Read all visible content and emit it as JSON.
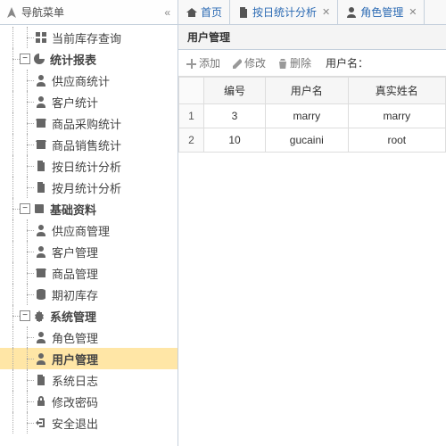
{
  "sidebar": {
    "title": "导航菜单",
    "items": [
      {
        "label": "当前库存查询",
        "indent": 2,
        "icon": "grid",
        "bold": false
      },
      {
        "label": "统计报表",
        "indent": 1,
        "icon": "pie",
        "expander": "-",
        "bold": true
      },
      {
        "label": "供应商统计",
        "indent": 2,
        "icon": "person",
        "bold": false
      },
      {
        "label": "客户统计",
        "indent": 2,
        "icon": "person",
        "bold": false
      },
      {
        "label": "商品采购统计",
        "indent": 2,
        "icon": "box",
        "bold": false
      },
      {
        "label": "商品销售统计",
        "indent": 2,
        "icon": "box",
        "bold": false
      },
      {
        "label": "按日统计分析",
        "indent": 2,
        "icon": "doc",
        "bold": false
      },
      {
        "label": "按月统计分析",
        "indent": 2,
        "icon": "doc",
        "bold": false
      },
      {
        "label": "基础资料",
        "indent": 1,
        "icon": "book",
        "expander": "-",
        "bold": true
      },
      {
        "label": "供应商管理",
        "indent": 2,
        "icon": "person",
        "bold": false
      },
      {
        "label": "客户管理",
        "indent": 2,
        "icon": "person",
        "bold": false
      },
      {
        "label": "商品管理",
        "indent": 2,
        "icon": "box",
        "bold": false
      },
      {
        "label": "期初库存",
        "indent": 2,
        "icon": "db",
        "bold": false
      },
      {
        "label": "系统管理",
        "indent": 1,
        "icon": "gear",
        "expander": "-",
        "bold": true
      },
      {
        "label": "角色管理",
        "indent": 2,
        "icon": "person",
        "bold": false
      },
      {
        "label": "用户管理",
        "indent": 2,
        "icon": "person",
        "bold": true,
        "selected": true
      },
      {
        "label": "系统日志",
        "indent": 2,
        "icon": "doc",
        "bold": false
      },
      {
        "label": "修改密码",
        "indent": 2,
        "icon": "lock",
        "bold": false
      },
      {
        "label": "安全退出",
        "indent": 2,
        "icon": "exit",
        "bold": false
      }
    ]
  },
  "tabs": [
    {
      "label": "首页",
      "icon": "home",
      "closable": false
    },
    {
      "label": "按日统计分析",
      "icon": "doc",
      "closable": true
    },
    {
      "label": "角色管理",
      "icon": "person",
      "closable": true
    }
  ],
  "panel": {
    "title": "用户管理"
  },
  "toolbar": {
    "add": "添加",
    "edit": "修改",
    "delete": "删除",
    "search_label": "用户名："
  },
  "grid": {
    "columns": [
      "编号",
      "用户名",
      "真实姓名"
    ],
    "rows": [
      {
        "num": "1",
        "id": "3",
        "username": "marry",
        "realname": "marry"
      },
      {
        "num": "2",
        "id": "10",
        "username": "gucaini",
        "realname": "root"
      }
    ]
  }
}
